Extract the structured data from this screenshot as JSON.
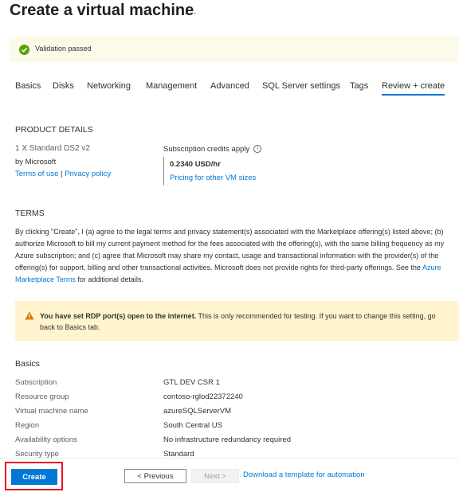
{
  "header": {
    "title": "Create a virtual machine",
    "more": "···"
  },
  "banner": {
    "text": "Validation passed",
    "color": "#57a300"
  },
  "tabs": [
    {
      "label": "Basics"
    },
    {
      "label": "Disks"
    },
    {
      "label": "Networking"
    },
    {
      "label": "Management"
    },
    {
      "label": "Advanced"
    },
    {
      "label": "SQL Server settings"
    },
    {
      "label": "Tags"
    },
    {
      "label": "Review + create",
      "active": true
    }
  ],
  "product": {
    "heading": "PRODUCT DETAILS",
    "name": "1 X Standard DS2 v2",
    "publisher": "by Microsoft",
    "terms_link": "Terms of use",
    "separator": "|",
    "privacy_link": "Privacy policy",
    "credits": "Subscription credits apply",
    "price": "0.2340 USD/hr",
    "pricing_link": "Pricing for other VM sizes"
  },
  "terms": {
    "heading": "TERMS",
    "text_before": "By clicking \"Create\", I (a) agree to the legal terms and privacy statement(s) associated with the Marketplace offering(s) listed above; (b) authorize Microsoft to bill my current payment method for the fees associated with the offering(s), with the same billing frequency as my Azure subscription; and (c) agree that Microsoft may share my contact, usage and transactional information with the provider(s) of the offering(s) for support, billing and other transactional activities. Microsoft does not provide rights for third-party offerings. See the ",
    "link": "Azure Marketplace Terms",
    "text_after": " for additional details."
  },
  "warning": {
    "bold": "You have set RDP port(s) open to the internet.",
    "text": " This is only recommended for testing.  If you want to change this setting, go back to Basics tab."
  },
  "basics": {
    "heading": "Basics",
    "rows": [
      {
        "key": "Subscription",
        "value": "GTL DEV CSR 1"
      },
      {
        "key": "Resource group",
        "value": "contoso-rglod22372240"
      },
      {
        "key": "Virtual machine name",
        "value": "azureSQLServerVM"
      },
      {
        "key": "Region",
        "value": "South Central US"
      },
      {
        "key": "Availability options",
        "value": "No infrastructure redundancy required"
      },
      {
        "key": "Security type",
        "value": "Standard"
      }
    ]
  },
  "footer": {
    "create": "Create",
    "previous": "< Previous",
    "next": "Next >",
    "download": "Download a template for automation"
  }
}
